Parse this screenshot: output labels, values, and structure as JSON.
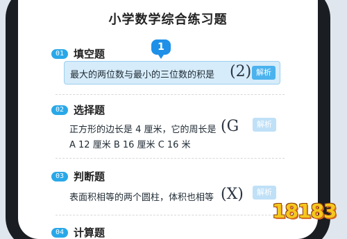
{
  "page_title": "小学数学综合练习题",
  "step_marker": "1",
  "sections": [
    {
      "number": "01",
      "title": "填空题",
      "lines": [
        "最大的两位数与最小的三位数的积是"
      ],
      "handwritten": "2",
      "button": "解析"
    },
    {
      "number": "02",
      "title": "选择题",
      "lines": [
        "正方形的边长是 4 厘米，它的周长是",
        "A  12 厘米     B  16 厘米     C  16 米"
      ],
      "handwritten": "G",
      "button": "解析"
    },
    {
      "number": "03",
      "title": "判断题",
      "lines": [
        "表面积相等的两个圆柱，体积也相等"
      ],
      "handwritten": "X",
      "button": "解析"
    },
    {
      "number": "04",
      "title": "计算题"
    }
  ],
  "logo": "18183",
  "colors": {
    "accent": "#29a8e8",
    "active_bg": "#d6ecfa",
    "marker": "#1e90e8"
  }
}
